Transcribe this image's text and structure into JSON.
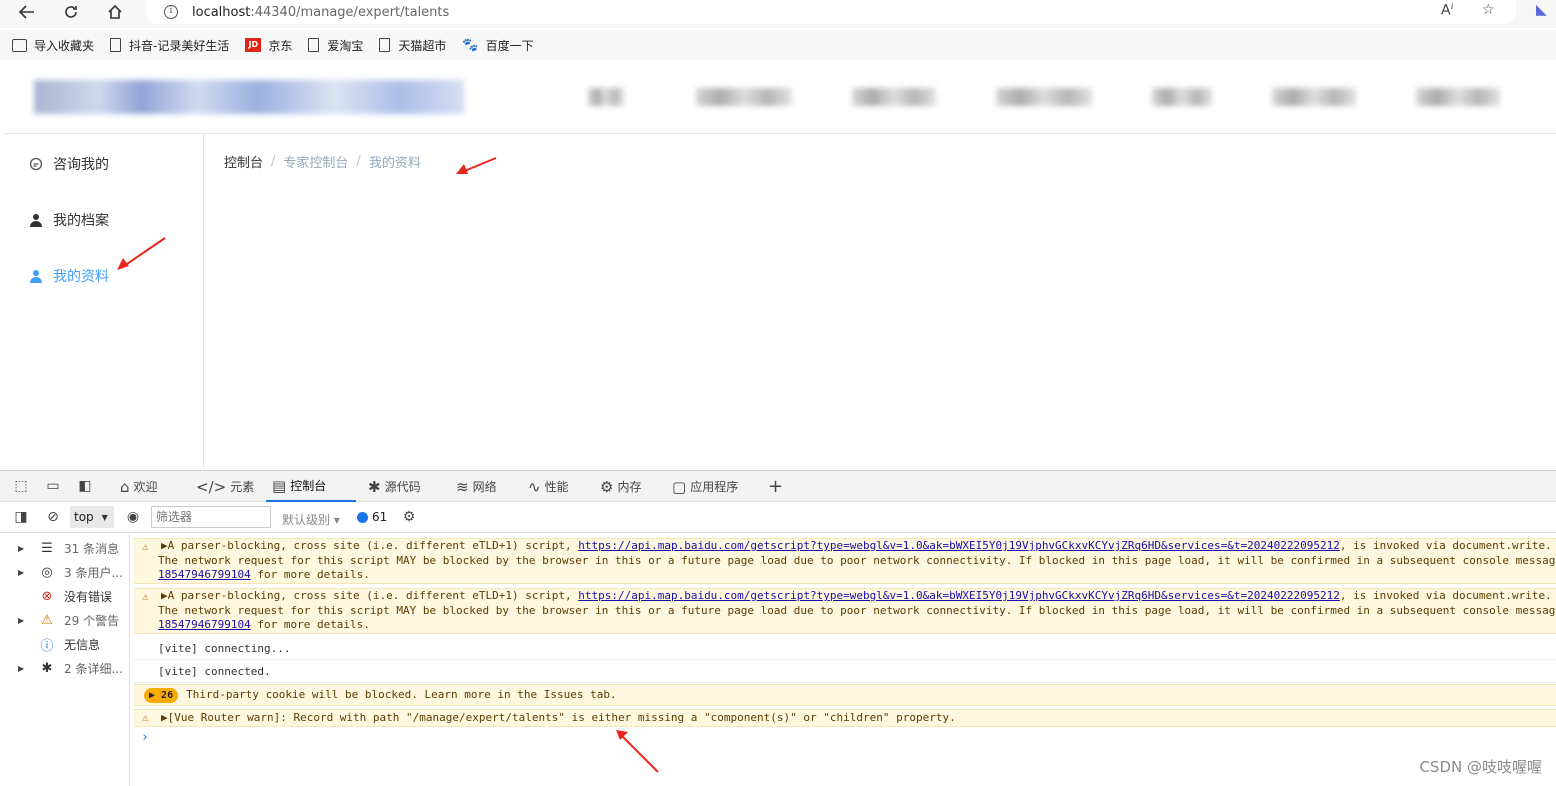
{
  "browser": {
    "url_host": "localhost",
    "url_rest": ":44340/manage/expert/talents",
    "bookmarks": [
      "导入收藏夹",
      "抖音-记录美好生活",
      "京东",
      "爱淘宝",
      "天猫超市",
      "百度一下"
    ]
  },
  "app": {
    "sidebar": {
      "items": [
        {
          "label": "咨询我的",
          "icon": "chat-icon",
          "active": false
        },
        {
          "label": "我的档案",
          "icon": "user-icon",
          "active": false
        },
        {
          "label": "我的资料",
          "icon": "user-icon",
          "active": true
        }
      ]
    },
    "breadcrumb": {
      "items": [
        "控制台",
        "专家控制台",
        "我的资料"
      ],
      "separator": "/"
    }
  },
  "devtools": {
    "tabs": [
      {
        "label": "欢迎",
        "icon": "home-icon"
      },
      {
        "label": "元素",
        "icon": "code-icon"
      },
      {
        "label": "控制台",
        "icon": "console-icon",
        "active": true
      },
      {
        "label": "源代码",
        "icon": "bug-icon"
      },
      {
        "label": "网络",
        "icon": "wifi-icon"
      },
      {
        "label": "性能",
        "icon": "performance-icon"
      },
      {
        "label": "内存",
        "icon": "memory-icon"
      },
      {
        "label": "应用程序",
        "icon": "application-icon"
      }
    ],
    "add_tab": "+",
    "toolbar": {
      "context": "top",
      "filter_placeholder": "筛选器",
      "level": "默认级别",
      "issues_count": "61"
    },
    "filters": [
      {
        "label": "31 条消息",
        "icon": "list-icon"
      },
      {
        "label": "3 条用户...",
        "icon": "user-circle-icon"
      },
      {
        "label": "没有错误",
        "icon": "error-icon"
      },
      {
        "label": "29 个警告",
        "icon": "warning-icon"
      },
      {
        "label": "无信息",
        "icon": "info-icon"
      },
      {
        "label": "2 条详细...",
        "icon": "bug-icon"
      }
    ],
    "messages": {
      "warn1_prefix": "▶A parser-blocking, cross site (i.e. different eTLD+1) script, ",
      "warn1_link": "https://api.map.baidu.com/getscript?type=webgl&v=1.0&ak=bWXEI5Y0j19VjphvGCkxvKCYvjZRq6HD&services=&t=20240222095212",
      "warn1_suffix": ", is invoked via document.write.",
      "warn1_line2": "The network request for this script MAY be blocked by the browser in this or a future page load due to poor network connectivity. If blocked in this page load, it will be confirmed in a subsequent console message.",
      "warn1_line3_link": "18547946799104",
      "warn1_line3_rest": " for more details.",
      "vite1": "[vite] connecting...",
      "vite2": "[vite] connected.",
      "cookie_badge": "26",
      "cookie": "Third-party cookie will be blocked. Learn more in the Issues tab.",
      "router": "▶[Vue Router warn]: Record with path \"/manage/expert/talents\" is either missing a \"component(s)\" or \"children\" property."
    },
    "prompt": "›"
  },
  "watermark": "CSDN @吱吱喔喔"
}
